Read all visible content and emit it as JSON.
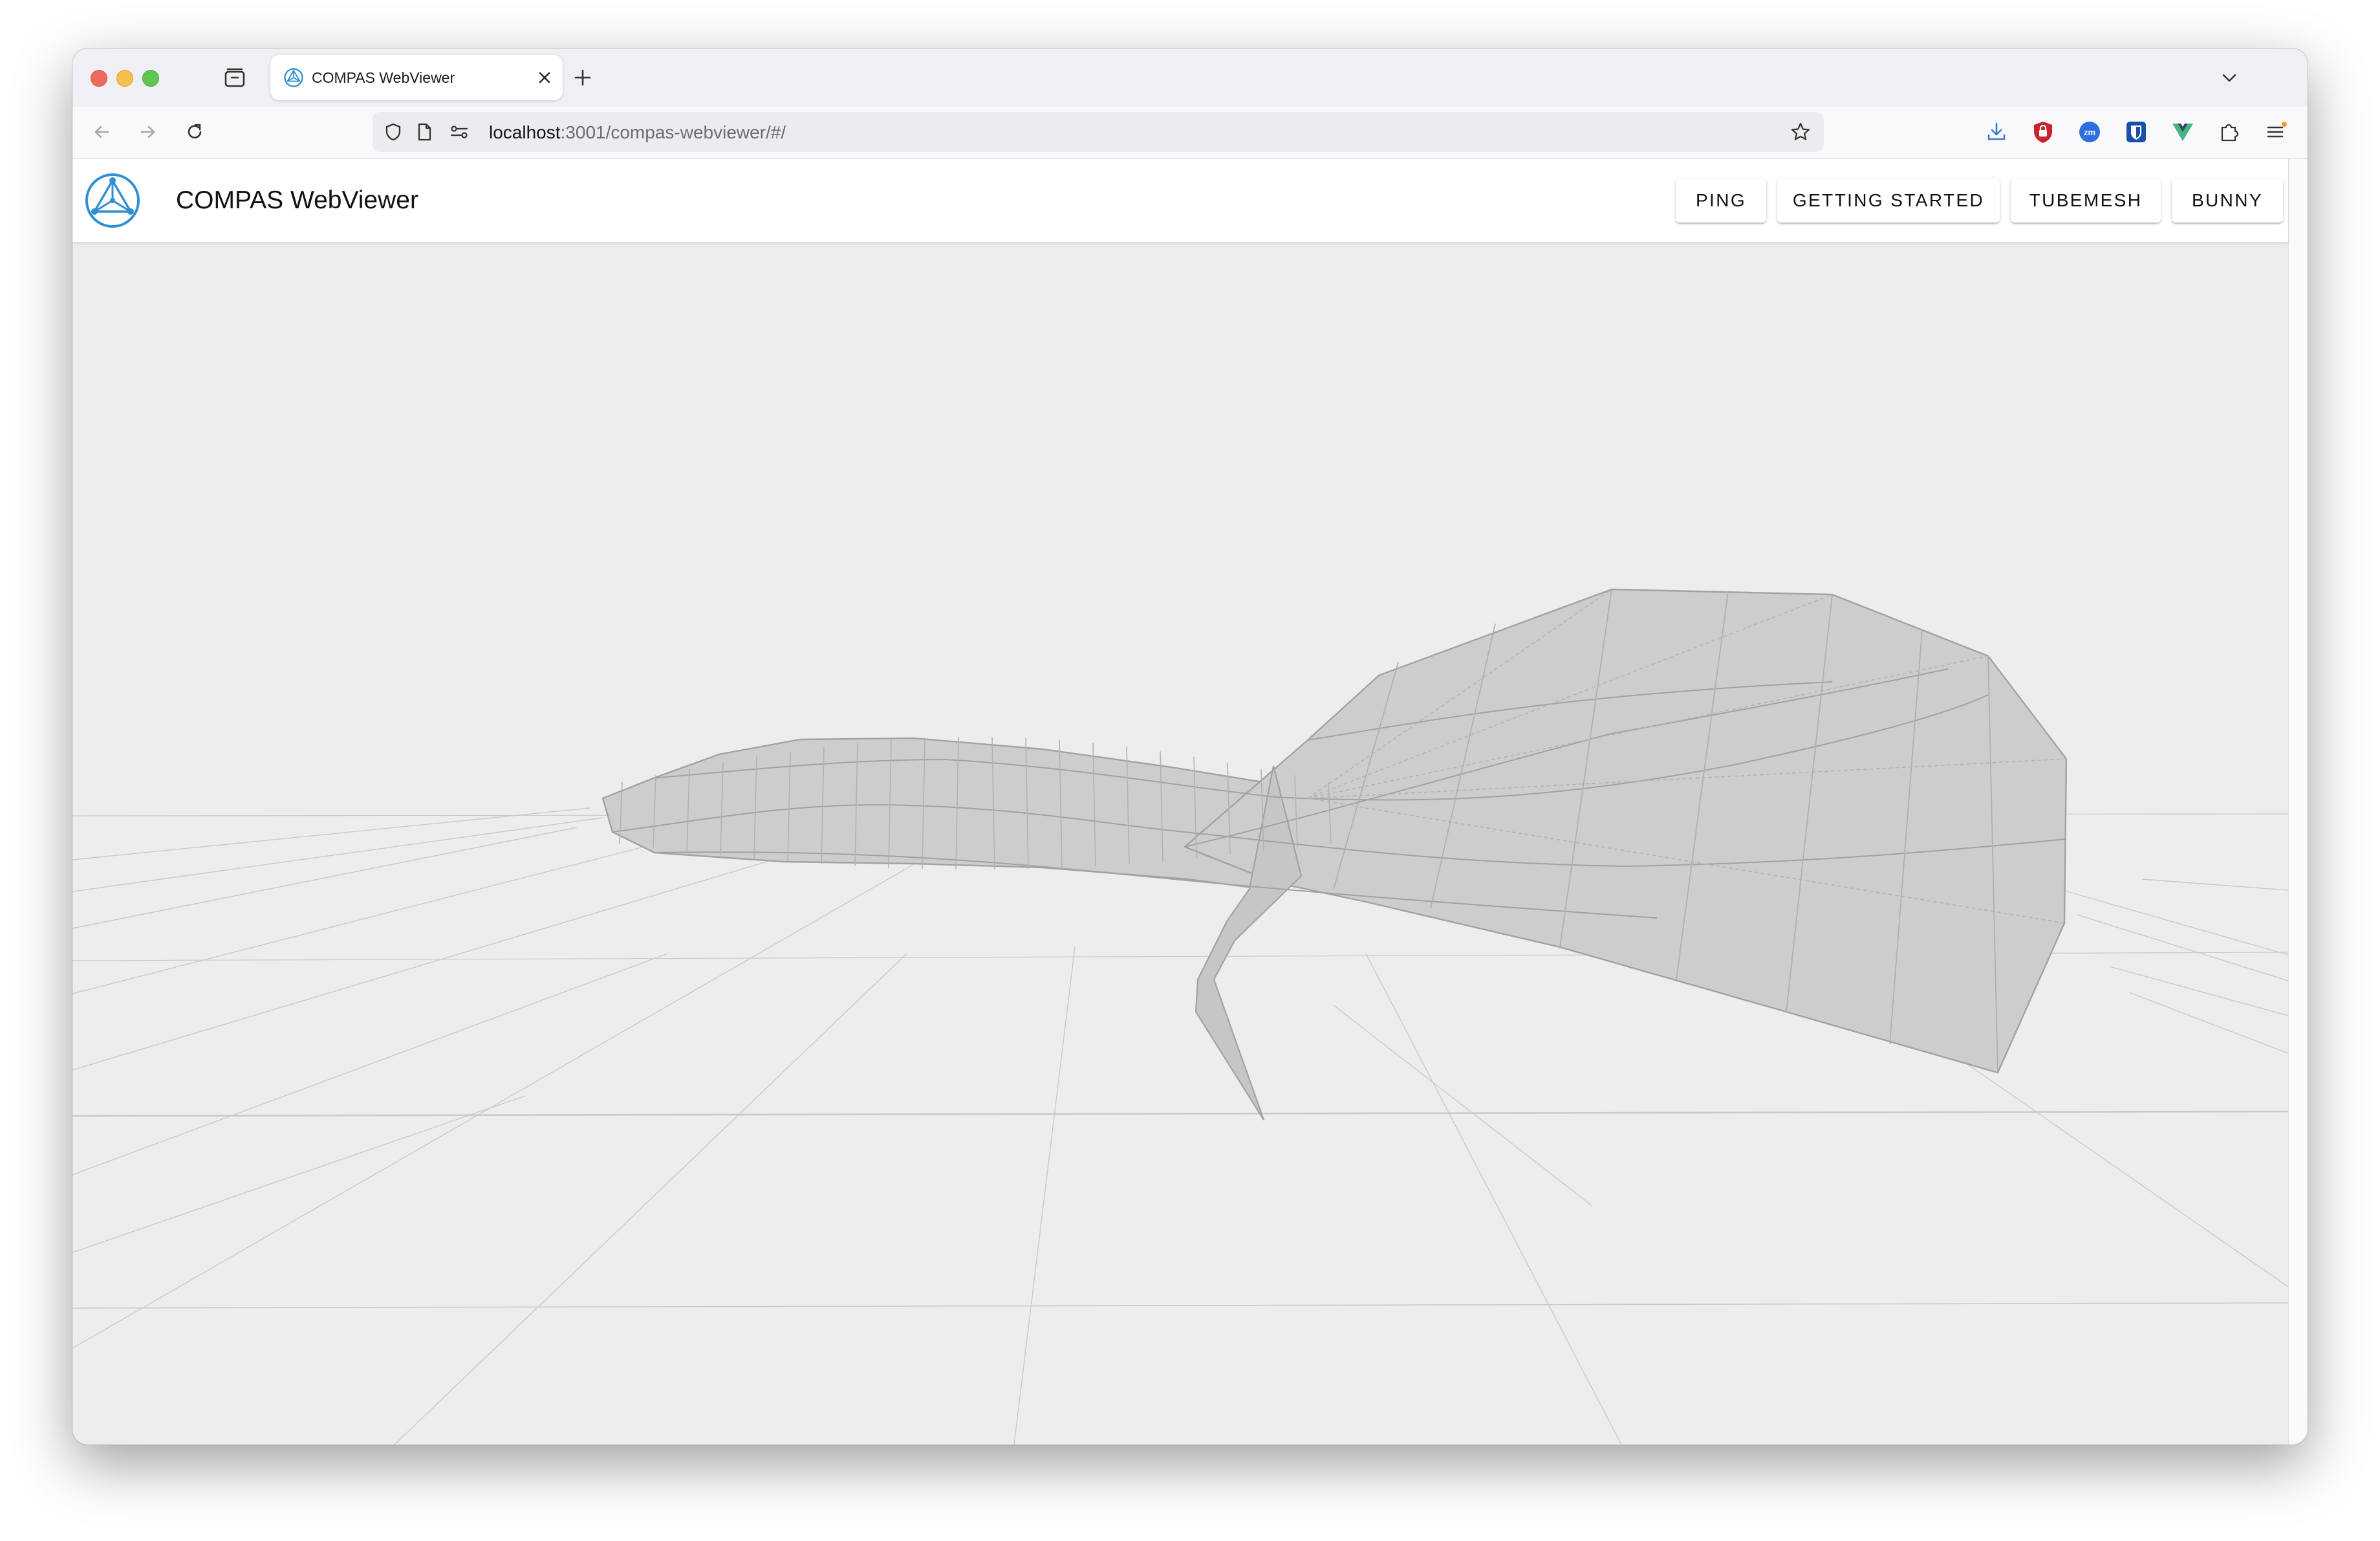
{
  "browser": {
    "tab": {
      "title": "COMPAS WebViewer"
    },
    "url": {
      "host": "localhost",
      "rest": ":3001/compas-webviewer/#/"
    },
    "icons": {
      "sidebar": "tab-list-icon",
      "new_tab": "plus-icon",
      "back": "arrow-left-icon",
      "forward": "arrow-right-icon",
      "reload": "reload-icon",
      "tracking": "shield-icon",
      "page": "page-icon",
      "permissions": "permissions-icon",
      "bookmark": "star-icon",
      "downloads": "download-icon",
      "extensions": [
        "ublock-icon",
        "zoom-icon",
        "bitwarden-icon",
        "vue-devtools-icon",
        "puzzle-icon"
      ],
      "menu": "hamburger-menu-icon",
      "list_all_tabs": "chevron-down-icon"
    }
  },
  "app": {
    "title": "COMPAS WebViewer",
    "buttons": [
      "PING",
      "GETTING STARTED",
      "TUBEMESH",
      "BUNNY"
    ],
    "colors": {
      "accent": "#2f8fd0",
      "viewport_bg": "#ededed",
      "mesh_fill": "#cdcdcd",
      "mesh_edge": "#a2a2a2",
      "grid": "#cacaca"
    }
  }
}
